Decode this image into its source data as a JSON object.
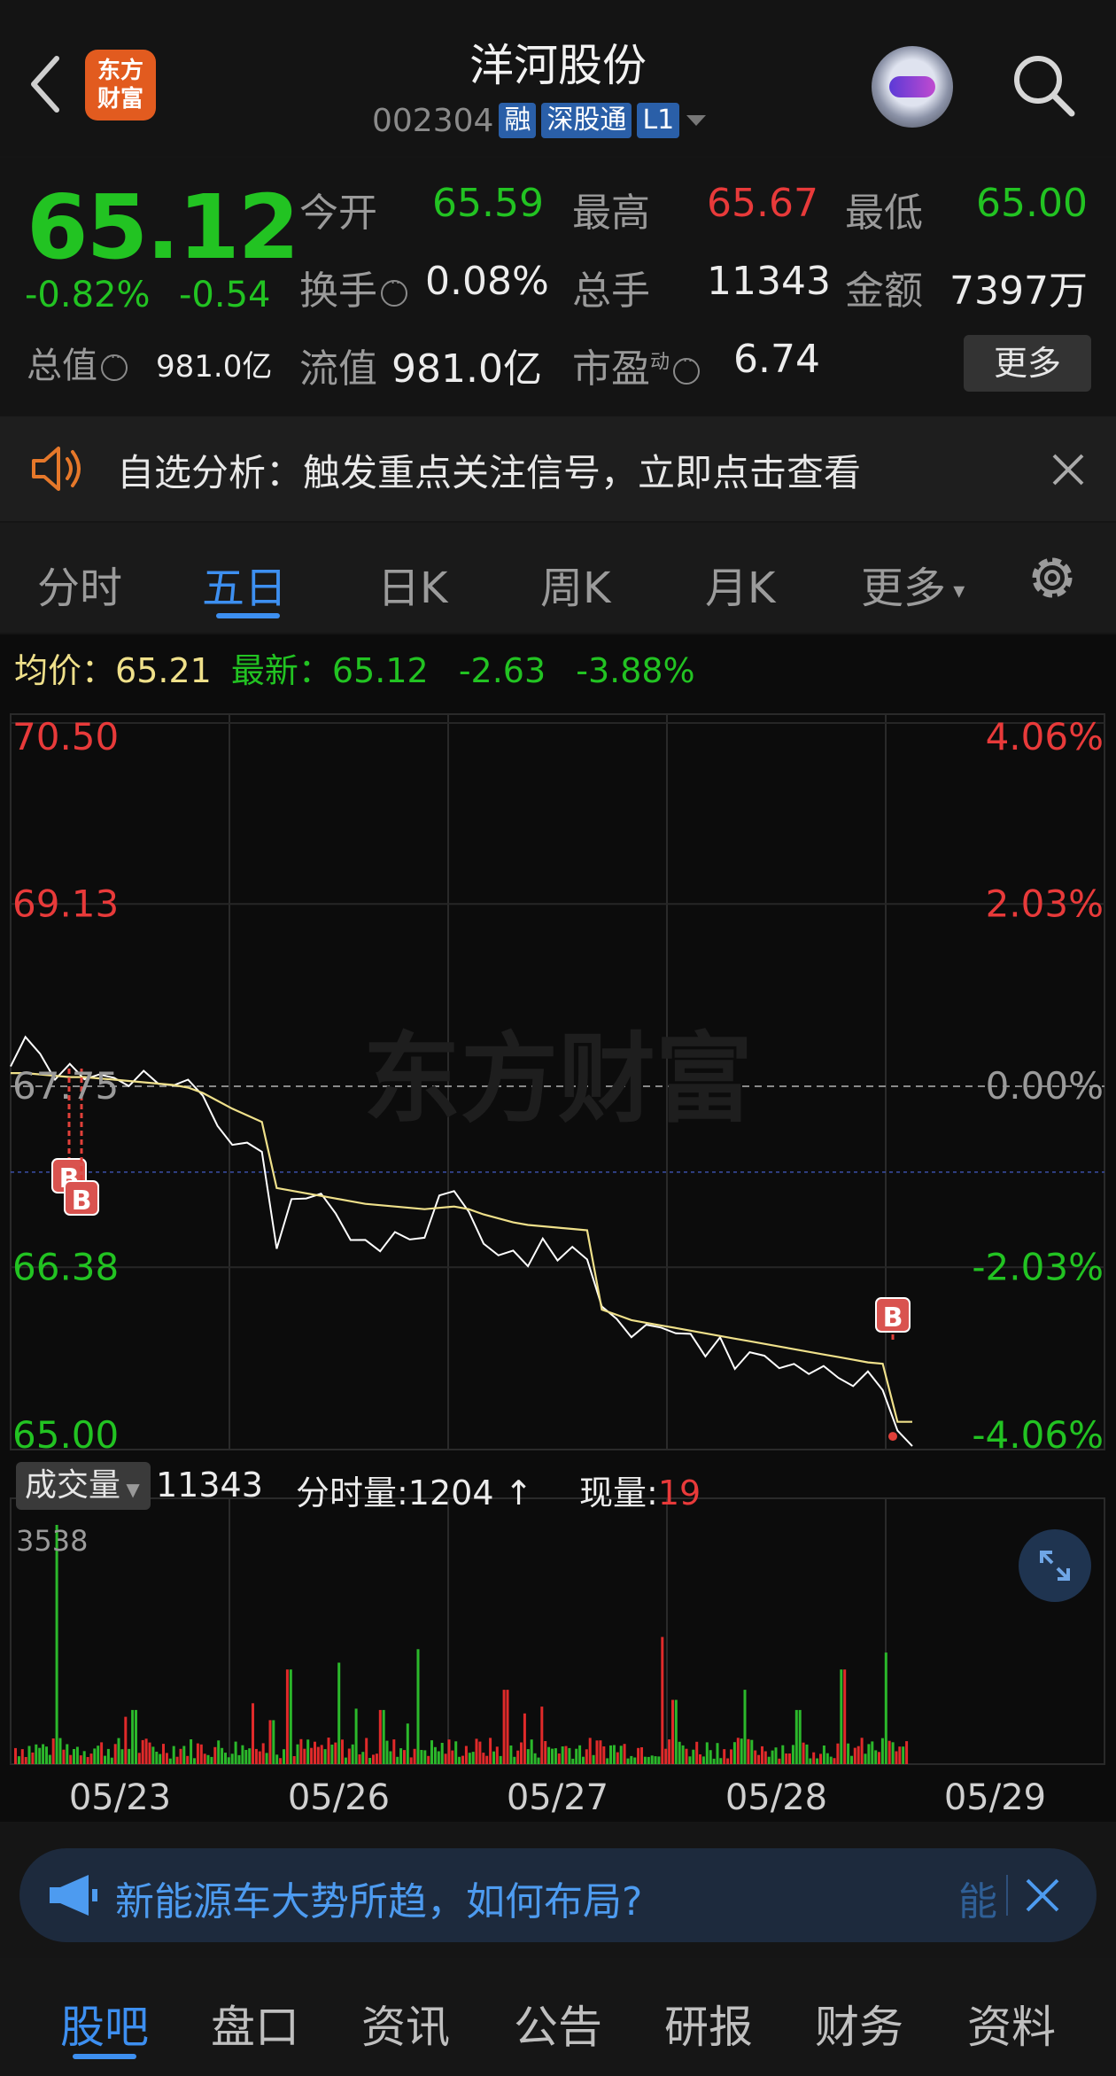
{
  "header": {
    "title": "洋河股份",
    "code": "002304",
    "tags": [
      "融",
      "深股通",
      "L1"
    ],
    "logo_text_line1": "东方",
    "logo_text_line2": "财富"
  },
  "quote": {
    "price": "65.12",
    "change_pct": "-0.82%",
    "change": "-0.54",
    "open_label": "今开",
    "open": "65.59",
    "high_label": "最高",
    "high": "65.67",
    "low_label": "最低",
    "low": "65.00",
    "turnover_label": "换手",
    "turnover": "0.08%",
    "volume_label": "总手",
    "volume": "11343",
    "amount_label": "金额",
    "amount": "7397万",
    "mcap_label": "总值",
    "mcap": "981.0亿",
    "float_label": "流值",
    "float": "981.0亿",
    "pe_label": "市盈",
    "pe_sup": "动",
    "pe": "6.74",
    "more_label": "更多"
  },
  "notice": {
    "text": "自选分析：触发重点关注信号，立即点击查看"
  },
  "tabs": [
    "分时",
    "五日",
    "日K",
    "周K",
    "月K",
    "更多"
  ],
  "active_tab": 1,
  "info_line": {
    "avg_label": "均价：",
    "avg": "65.21",
    "latest_label": "最新：",
    "latest": "65.12",
    "diff": "-2.63",
    "diff_pct": "-3.88%"
  },
  "chart_data": {
    "type": "line",
    "title": "",
    "x_labels": [
      "05/23",
      "05/26",
      "05/27",
      "05/28",
      "05/29"
    ],
    "y_ticks_left": [
      "70.50",
      "69.13",
      "67.75",
      "66.38",
      "65.00"
    ],
    "y_ticks_right": [
      "4.06%",
      "2.03%",
      "0.00%",
      "-2.03%",
      "-4.06%"
    ],
    "ylim": [
      65.0,
      70.5
    ],
    "prev_close": 67.75,
    "watermark": "东方财富",
    "series": [
      {
        "color": "#ffffff",
        "values": [
          67.9,
          68.15,
          67.95,
          67.85,
          67.88,
          67.82,
          67.85,
          67.78,
          67.8,
          67.82,
          67.8,
          67.75,
          67.78,
          67.72,
          67.4,
          67.35,
          67.3,
          67.25,
          66.55,
          66.85,
          66.95,
          66.9,
          66.8,
          66.6,
          66.55,
          66.55,
          66.6,
          66.62,
          66.6,
          66.9,
          67.0,
          66.75,
          66.6,
          66.45,
          66.5,
          66.42,
          66.55,
          66.48,
          66.5,
          66.45,
          66.1,
          65.95,
          65.9,
          65.9,
          65.95,
          65.88,
          65.85,
          65.75,
          65.8,
          65.65,
          65.72,
          65.7,
          65.65,
          65.6,
          65.62,
          65.6,
          65.55,
          65.5,
          65.55,
          65.5,
          65.1,
          65.05
        ]
      },
      {
        "color": "#efe08a",
        "values": [
          67.85,
          67.85,
          67.84,
          67.83,
          67.82,
          67.82,
          67.81,
          67.8,
          67.79,
          67.78,
          67.77,
          67.76,
          67.74,
          67.7,
          67.64,
          67.58,
          67.53,
          67.48,
          66.98,
          66.96,
          66.94,
          66.92,
          66.9,
          66.88,
          66.86,
          66.85,
          66.84,
          66.83,
          66.82,
          66.83,
          66.84,
          66.82,
          66.78,
          66.75,
          66.72,
          66.7,
          66.69,
          66.68,
          66.67,
          66.66,
          66.06,
          66.02,
          65.98,
          65.96,
          65.94,
          65.92,
          65.9,
          65.88,
          65.86,
          65.84,
          65.82,
          65.8,
          65.78,
          65.76,
          65.74,
          65.72,
          65.7,
          65.68,
          65.66,
          65.65,
          65.21,
          65.21
        ]
      }
    ],
    "trade_markers": [
      "B",
      "B",
      "B"
    ]
  },
  "volume": {
    "dropdown_label": "成交量",
    "total": "11343",
    "tick_label": "分时量:1204",
    "now_label": "现量:",
    "now_val": "19",
    "ymax_label": "3538",
    "ymax": 3538
  },
  "banner": {
    "text": "新能源车大势所趋，如何布局?",
    "tail": "能"
  },
  "bottom_nav": [
    "股吧",
    "盘口",
    "资讯",
    "公告",
    "研报",
    "财务",
    "资料"
  ],
  "bottom_active": 0,
  "colors": {
    "up": "#e83a3a",
    "down": "#22c322",
    "accent": "#3d8ff0",
    "avg": "#efe08a"
  }
}
